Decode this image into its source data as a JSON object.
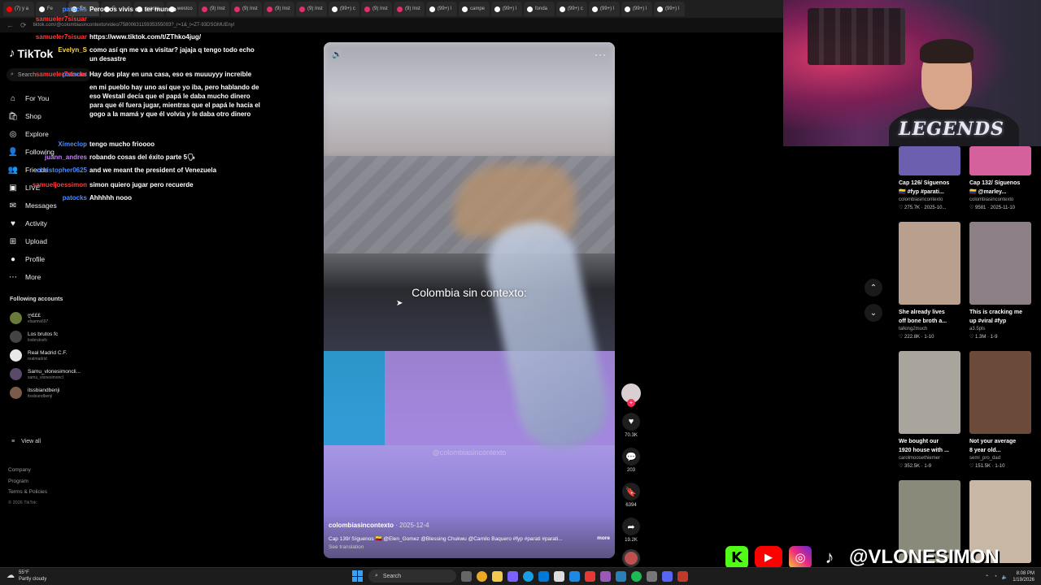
{
  "browser": {
    "tabs": [
      {
        "label": "(7) y a",
        "color": "#ff0000"
      },
      {
        "label": "Fe",
        "color": "#ffffff"
      },
      {
        "label": "Ex",
        "color": "#ffffff"
      },
      {
        "label": "F",
        "color": "#ffffff"
      },
      {
        "label": "cuanto",
        "color": "#ffffff"
      },
      {
        "label": "westco",
        "color": "#ffffff"
      },
      {
        "label": "(9) Inst",
        "color": "#e1306c"
      },
      {
        "label": "(9) Inst",
        "color": "#e1306c"
      },
      {
        "label": "(9) Inst",
        "color": "#e1306c"
      },
      {
        "label": "(9) Inst",
        "color": "#e1306c"
      },
      {
        "label": "(99+) c",
        "color": "#ffffff"
      },
      {
        "label": "(9) Inst",
        "color": "#e1306c"
      },
      {
        "label": "(9) Inst",
        "color": "#e1306c"
      },
      {
        "label": "(99+) I",
        "color": "#ffffff"
      },
      {
        "label": "campe",
        "color": "#ffffff"
      },
      {
        "label": "(99+) I",
        "color": "#ffffff"
      },
      {
        "label": "fonda",
        "color": "#ffffff"
      },
      {
        "label": "(99+) c",
        "color": "#ffffff"
      },
      {
        "label": "(99+) I",
        "color": "#ffffff"
      },
      {
        "label": "(99+) I",
        "color": "#ffffff"
      },
      {
        "label": "(99+) I",
        "color": "#ffffff"
      }
    ],
    "url": "tiktok.com/@colombiasincontexto/video/7580063115935355093?_r=1&_t=ZT-93DSGMUEnyl"
  },
  "sidebar": {
    "logo": "TikTok",
    "search_placeholder": "Search",
    "nav": [
      {
        "label": "For You",
        "icon": "home-icon",
        "glyph": "⌂"
      },
      {
        "label": "Shop",
        "icon": "shop-icon",
        "glyph": "🛍"
      },
      {
        "label": "Explore",
        "icon": "compass-icon",
        "glyph": "◎"
      },
      {
        "label": "Following",
        "icon": "following-icon",
        "glyph": "👤"
      },
      {
        "label": "Friends",
        "icon": "friends-icon",
        "glyph": "👥"
      },
      {
        "label": "LIVE",
        "icon": "live-icon",
        "glyph": "▣"
      },
      {
        "label": "Messages",
        "icon": "messages-icon",
        "glyph": "✉"
      },
      {
        "label": "Activity",
        "icon": "activity-icon",
        "glyph": "♥"
      },
      {
        "label": "Upload",
        "icon": "upload-icon",
        "glyph": "⊞"
      },
      {
        "label": "Profile",
        "icon": "profile-icon",
        "glyph": "●"
      },
      {
        "label": "More",
        "icon": "more-icon",
        "glyph": "⋯"
      }
    ],
    "following_title": "Following accounts",
    "accounts": [
      {
        "name": "ღ£££",
        "handle": "elsamw697"
      },
      {
        "name": "Los brutos fc",
        "handle": "losbrutosfc"
      },
      {
        "name": "Real Madrid C.F.",
        "handle": "realmadrid"
      },
      {
        "name": "Samu_vlonesimoncli...",
        "handle": "samu_vlonesimoncl"
      },
      {
        "name": "itssbiandbenji",
        "handle": "itssbiandbenji"
      }
    ],
    "view_all": "View all",
    "footer": [
      "Company",
      "Program",
      "Terms & Policies"
    ],
    "copyright": "© 2026 TikTok"
  },
  "chat": [
    {
      "user": "patocks",
      "color": "#4a8cff",
      "text": "Pero vos vivis en ter mundo"
    },
    {
      "user": "samueler7sisuar",
      "color": "#ff3b3b",
      "text": ""
    },
    {
      "user": "samueler7sisuar",
      "color": "#ff3b3b",
      "text": "https://www.tiktok.com/t/ZThko4jug/"
    },
    {
      "user": "Evelyn_S",
      "color": "#ffd54a",
      "text": "como así qn me va a visitar? jajaja q tengo todo echo un desastre"
    },
    {
      "user": "patocks",
      "color": "#4a8cff",
      "text": ""
    },
    {
      "user": "samueler7sisuar",
      "color": "#ff3b3b",
      "text": "Hay dos play en una casa, eso es muuuyyy increíble"
    },
    {
      "user": "",
      "color": "#ffffff",
      "text": "en mi pueblo hay uno así que yo iba, pero hablando de eso Westall decía que el papá le daba mucho dinero para que él fuera jugar, mientras que el papá le hacía el gogo a la mamá y que él volvía y le daba otro dinero"
    },
    {
      "user": "Ximeclop",
      "color": "#4a8cff",
      "text": "tengo mucho frioooo"
    },
    {
      "user": "juann_andres",
      "color": "#c77dff",
      "text": "robando cosas del éxito parte 5🗣"
    },
    {
      "user": "christopher0625",
      "color": "#4a8cff",
      "text": "and we meant the president of Venezuela"
    },
    {
      "user": "samueljoessimon",
      "color": "#ff3b3b",
      "text": "simon quiero jugar pero recuerde"
    },
    {
      "user": "patocks",
      "color": "#4a8cff",
      "text": "Ahhhhh nooo"
    }
  ],
  "video": {
    "overlay_text": "Colombia sin contexto:",
    "watermark": "@colombiasincontexto",
    "author": "colombiasincontexto",
    "date": "· 2025-12-4",
    "description": "Cap 139/ Síguenos 🇨🇴 @Elen_Gomez @Blessing Chukwu @Camilo Baquero #fyp #parati #parati...",
    "more": "more",
    "see_translation": "See translation",
    "likes": "70.3K",
    "comments": "203",
    "saves": "6394",
    "shares": "19.2K"
  },
  "suggestions": [
    {
      "title": "Cap 126/ Síguenos",
      "sub": "🇨🇴 #fyp #parati...",
      "channel": "colombiasincontexto",
      "likes": "275.7K",
      "date": "2025-10...",
      "thumb": "#6c5fb0"
    },
    {
      "title": "Cap 132/ Síguenos",
      "sub": "🇨🇴 @marley...",
      "channel": "colombiasincontexto",
      "likes": "9581",
      "date": "2025-11-10",
      "thumb": "#d4609c"
    },
    {
      "title": "She already lives",
      "sub": "off bone broth a...",
      "channel": "talking2much",
      "likes": "222.8K",
      "date": "1-10",
      "thumb": "#b89f8e"
    },
    {
      "title": "This is cracking me",
      "sub": "up #viral #fyp",
      "channel": "a3.5pls",
      "likes": "1.3M",
      "date": "1-9",
      "thumb": "#8c7f86"
    },
    {
      "title": "We bought our",
      "sub": "1920 house with ...",
      "channel": "carolmoosethiemer",
      "likes": "352.5K",
      "date": "1-9",
      "thumb": "#a9a49c"
    },
    {
      "title": "Not your average",
      "sub": "8 year old...",
      "channel": "semi_pro_dad",
      "likes": "151.5K",
      "date": "1-10",
      "thumb": "#6b4a3a"
    },
    {
      "title": "",
      "sub": "",
      "channel": "",
      "likes": "",
      "date": "",
      "thumb": "#8a8a7a"
    },
    {
      "title": "",
      "sub": "",
      "channel": "",
      "likes": "",
      "date": "",
      "thumb": "#c9b7a6"
    }
  ],
  "overlay": {
    "cam_brand": "LEGENDS",
    "handle": "@VLONESIMON"
  },
  "taskbar": {
    "temp": "55°F",
    "weather": "Partly cloudy",
    "search": "Search",
    "time": "8:08 PM",
    "date": "1/19/2026"
  }
}
